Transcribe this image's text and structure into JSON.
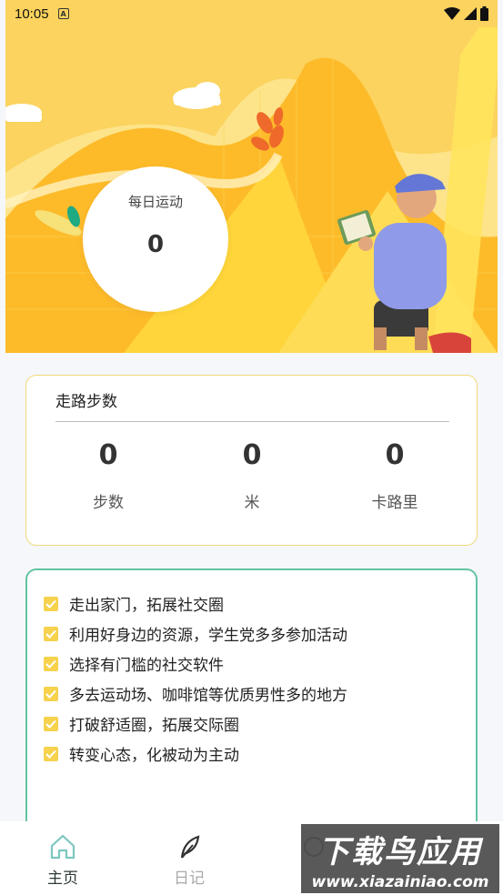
{
  "status_bar": {
    "time": "10:05",
    "a_icon": "A"
  },
  "hero": {
    "daily_title": "每日运动",
    "daily_value": "0"
  },
  "stats": {
    "title": "走路步数",
    "items": [
      {
        "value": "0",
        "label": "步数"
      },
      {
        "value": "0",
        "label": "米"
      },
      {
        "value": "0",
        "label": "卡路里"
      }
    ]
  },
  "tips": [
    "走出家门，拓展社交圈",
    "利用好身边的资源，学生党多多参加活动",
    "选择有门槛的社交软件",
    "多去运动场、咖啡馆等优质男性多的地方",
    "打破舒适圈，拓展交际圈",
    "转变心态，化被动为主动"
  ],
  "nav": {
    "items": [
      {
        "label": "主页",
        "icon": "home-icon",
        "active": true
      },
      {
        "label": "日记",
        "icon": "feather-icon",
        "active": false
      },
      {
        "label": "",
        "icon": "nav-icon",
        "active": false
      },
      {
        "label": "",
        "icon": "nav-icon",
        "active": false
      }
    ]
  },
  "watermark": {
    "title": "下载鸟应用",
    "url": "www.xiazainiao.com"
  },
  "colors": {
    "accent_yellow": "#fbd35e",
    "tips_border": "#63c3a3",
    "check": "#f6d24d"
  }
}
